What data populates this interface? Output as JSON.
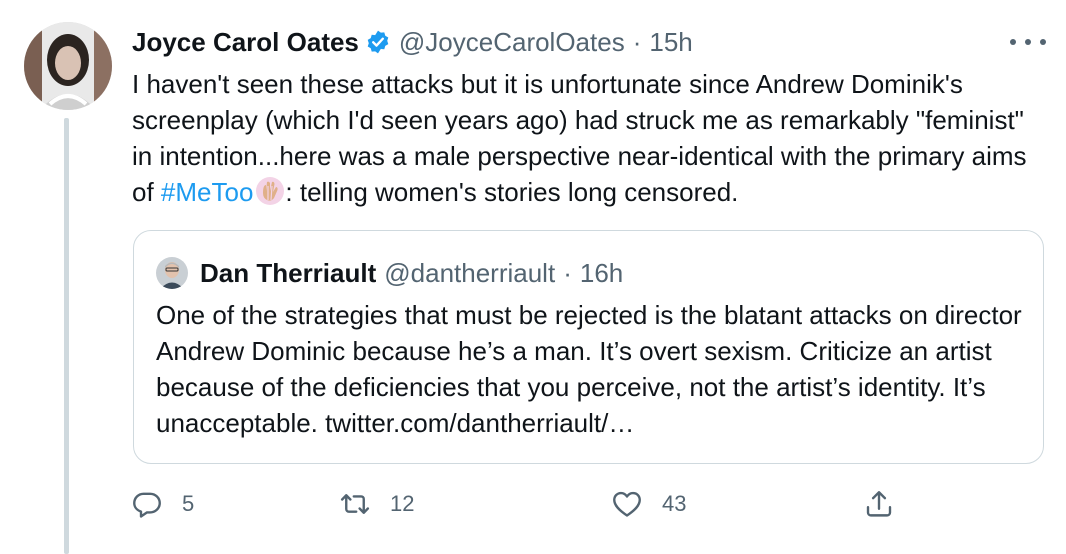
{
  "author": {
    "display_name": "Joyce Carol Oates",
    "handle": "@JoyceCarolOates",
    "separator": "·",
    "time": "15h",
    "verified": true,
    "avatar_icon": "profile-photo"
  },
  "tweet": {
    "text_before_hashtag": "I haven't seen these attacks but it is unfortunate since Andrew Dominik's screenplay (which I'd seen years ago) had struck me as remarkably \"feminist\" in intention...here was a male perspective near-identical with the primary aims of ",
    "hashtag": "#MeToo",
    "emoji_icon": "raised-hand-emoji",
    "text_after_emoji": ": telling women's stories long censored."
  },
  "quoted_tweet": {
    "display_name": "Dan Therriault",
    "handle": "@dantherriault",
    "separator": "·",
    "time": "16h",
    "text": "One of the strategies that must be rejected is the blatant attacks on director Andrew Dominic because he’s a man. It’s overt sexism. Criticize an artist because of the deficiencies that you perceive, not the artist’s identity. It’s unacceptable. twitter.com/dantherriault/…"
  },
  "actions": {
    "reply_count": "5",
    "retweet_count": "12",
    "like_count": "43"
  },
  "colors": {
    "text_primary": "#0f1419",
    "text_secondary": "#536471",
    "accent": "#1d9bf0",
    "border": "#cfd9de"
  },
  "icons": [
    "more-icon",
    "verified-icon",
    "reply-icon",
    "retweet-icon",
    "like-icon",
    "share-icon"
  ]
}
